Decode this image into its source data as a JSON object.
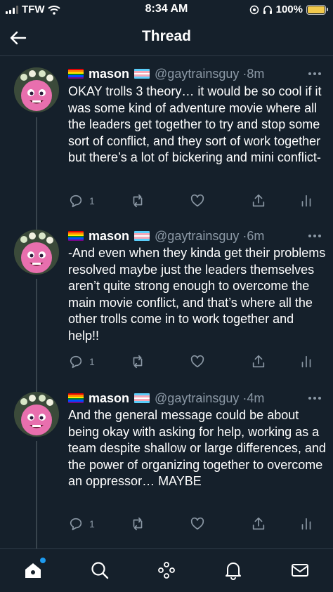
{
  "status_bar": {
    "carrier": "TFW",
    "time": "8:34 AM",
    "battery": "100%",
    "battery_level": 1.0
  },
  "header": {
    "title": "Thread"
  },
  "tweets": [
    {
      "name": "mason",
      "handle": "@gaytrainsguy",
      "time": "8m",
      "text": "OKAY trolls 3 theory… it would be so cool if it was some kind of adventure movie where all the leaders get together to try and stop some sort of conflict, and they sort of work together but there’s a lot of bickering and mini conflict-",
      "reply_count": "1"
    },
    {
      "name": "mason",
      "handle": "@gaytrainsguy",
      "time": "6m",
      "text": "-And even when they kinda get their problems resolved maybe just the leaders themselves aren’t quite strong enough to overcome the main movie conflict, and that’s where all the other trolls come in to work together and help!!",
      "reply_count": "1"
    },
    {
      "name": "mason",
      "handle": "@gaytrainsguy",
      "time": "4m",
      "text": "And the general message could be about being okay with asking for help, working as a team despite shallow or large differences, and the power of organizing together to overcome an oppressor… MAYBE",
      "reply_count": "1"
    }
  ],
  "nav": {
    "items": [
      "home-icon",
      "search-icon",
      "spaces-icon",
      "notifications-icon",
      "messages-icon"
    ]
  },
  "colors": {
    "background": "#15202b",
    "secondary_text": "#8b98a5",
    "accent": "#1d9bf0",
    "battery": "#f2c94c"
  }
}
